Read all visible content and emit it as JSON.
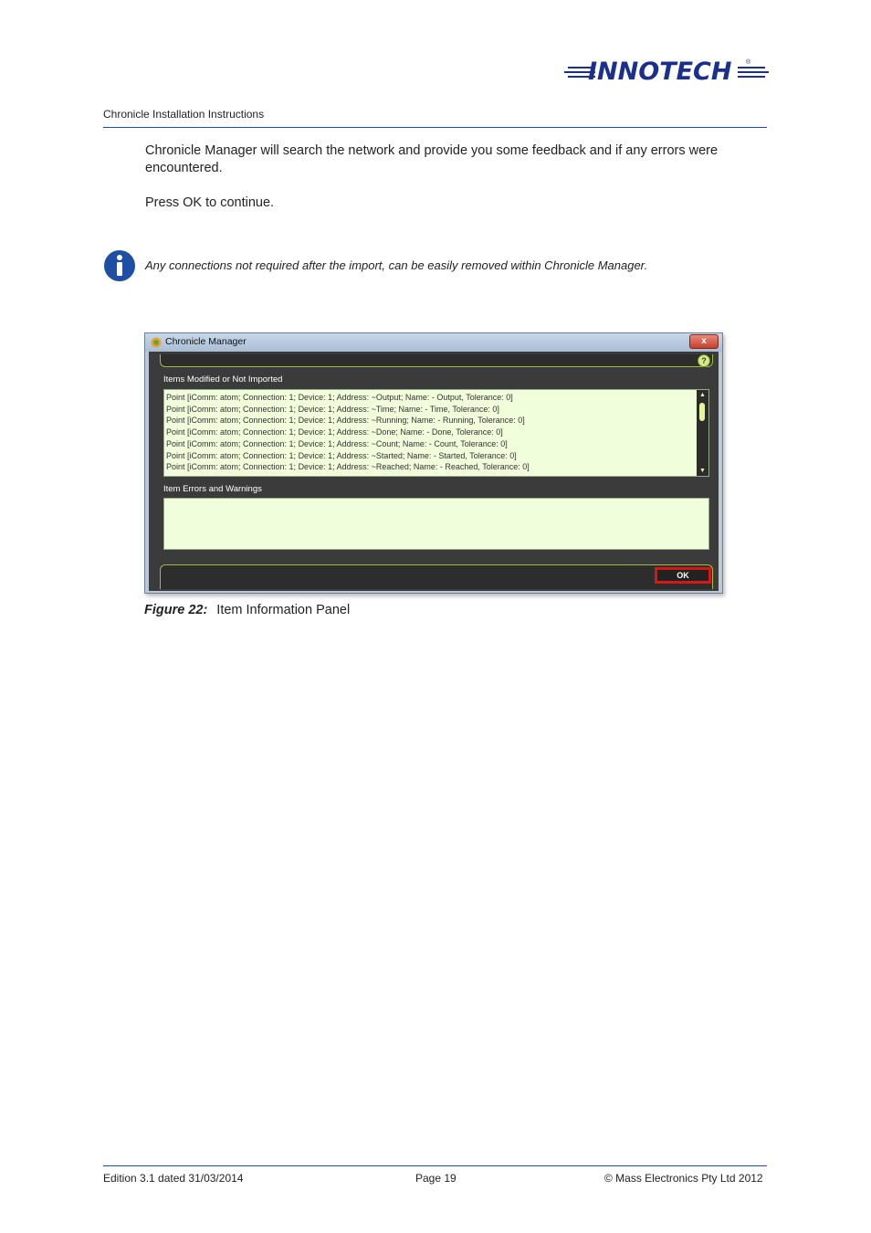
{
  "header": {
    "logo_text": "INNOTECH",
    "logo_mark": "®",
    "running_title": "Chronicle Installation Instructions",
    "brand_color": "#1b2f8c"
  },
  "body": {
    "paragraph1": "Chronicle Manager will search the network and provide you some feedback and if any errors were encountered.",
    "paragraph2": "Press OK to continue.",
    "info_icon": "info-icon",
    "info_note": "Any connections not required after the import, can be easily removed within Chronicle Manager."
  },
  "dialog": {
    "title": "Chronicle Manager",
    "close_glyph": "x",
    "help_glyph": "?",
    "items_label": "Items Modified or Not Imported",
    "items": [
      "Point [iComm: atom; Connection: 1; Device: 1; Address: ~Output; Name:  - Output, Tolerance: 0]",
      "Point [iComm: atom; Connection: 1; Device: 1; Address: ~Time; Name:  - Time, Tolerance: 0]",
      "Point [iComm: atom; Connection: 1; Device: 1; Address: ~Running; Name:  - Running, Tolerance: 0]",
      "Point [iComm: atom; Connection: 1; Device: 1; Address: ~Done; Name:  - Done, Tolerance: 0]",
      "Point [iComm: atom; Connection: 1; Device: 1; Address: ~Count; Name:  - Count, Tolerance: 0]",
      "Point [iComm: atom; Connection: 1; Device: 1; Address: ~Started; Name:  - Started, Tolerance: 0]",
      "Point [iComm: atom; Connection: 1; Device: 1; Address: ~Reached; Name:  - Reached, Tolerance: 0]"
    ],
    "errors_label": "Item Errors and Warnings",
    "ok_label": "OK",
    "accent_color": "#9bbf3c",
    "highlight_color": "#d61717"
  },
  "caption": {
    "figure_label": "Figure 22:",
    "text": "Item Information Panel"
  },
  "footer": {
    "edition": "Edition 3.1 dated 31/03/2014",
    "page": "Page 19",
    "copyright": "©  Mass Electronics Pty Ltd  2012"
  }
}
